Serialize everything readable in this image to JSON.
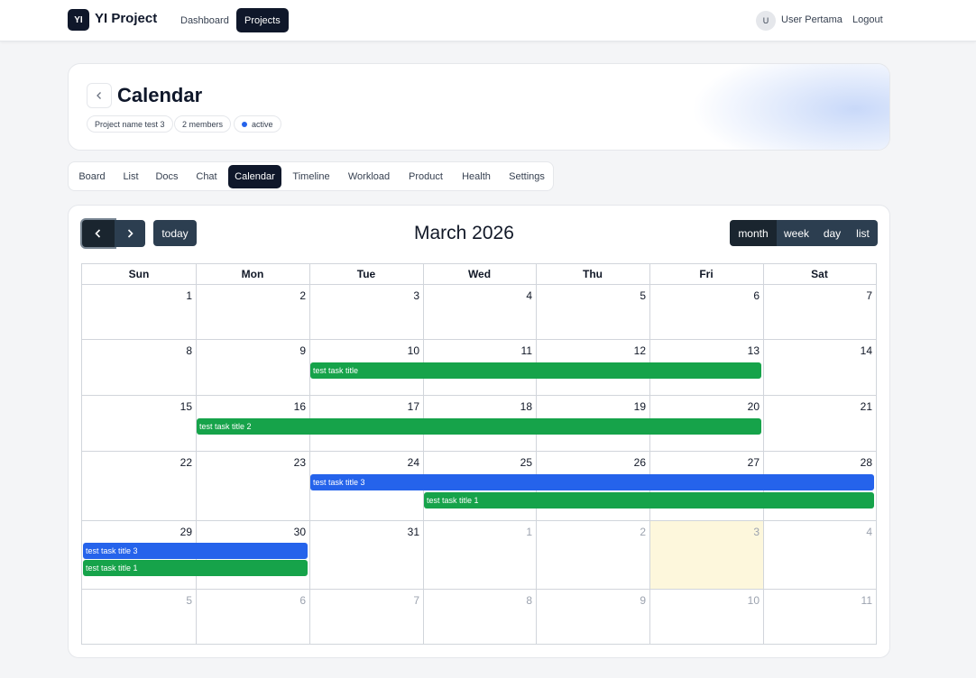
{
  "nav": {
    "logo": "YI",
    "app_title": "YI Project",
    "links": [
      "Dashboard",
      "Projects"
    ],
    "avatar_initial": "U",
    "user_name": "User Pertama",
    "logout": "Logout"
  },
  "header": {
    "back_icon": "chevron-left-icon",
    "title": "Calendar",
    "chips": [
      "Project name test 3",
      "2 members",
      "active"
    ]
  },
  "tabs": [
    "Board",
    "List",
    "Docs",
    "Chat",
    "Calendar",
    "Timeline",
    "Workload",
    "Product",
    "Health",
    "Settings"
  ],
  "calendar": {
    "prev_icon": "chevron-left-icon",
    "next_icon": "chevron-right-icon",
    "today_label": "today",
    "title": "March 2026",
    "views": [
      "month",
      "week",
      "day",
      "list"
    ],
    "weekdays": [
      "Sun",
      "Mon",
      "Tue",
      "Wed",
      "Thu",
      "Fri",
      "Sat"
    ],
    "weeks": [
      [
        "1",
        "2",
        "3",
        "4",
        "5",
        "6",
        "7"
      ],
      [
        "8",
        "9",
        "10",
        "11",
        "12",
        "13",
        "14"
      ],
      [
        "15",
        "16",
        "17",
        "18",
        "19",
        "20",
        "21"
      ],
      [
        "22",
        "23",
        "24",
        "25",
        "26",
        "27",
        "28"
      ],
      [
        "29",
        "30",
        "31",
        "1",
        "2",
        "3",
        "4"
      ],
      [
        "5",
        "6",
        "7",
        "8",
        "9",
        "10",
        "11"
      ]
    ],
    "events": [
      {
        "title": "test task title",
        "color": "#16a34a"
      },
      {
        "title": "test task title 2",
        "color": "#16a34a"
      },
      {
        "title": "test task title 3",
        "color": "#2563eb"
      },
      {
        "title": "test task title 1",
        "color": "#16a34a"
      },
      {
        "title": "test task title 3",
        "color": "#2563eb"
      },
      {
        "title": "test task title 1",
        "color": "#16a34a"
      }
    ]
  },
  "colors": {
    "primary": "#0f172a",
    "calendar_button": "#2c3e50",
    "today_highlight": "#fdf7dc",
    "event_green": "#16a34a",
    "event_blue": "#2563eb"
  }
}
